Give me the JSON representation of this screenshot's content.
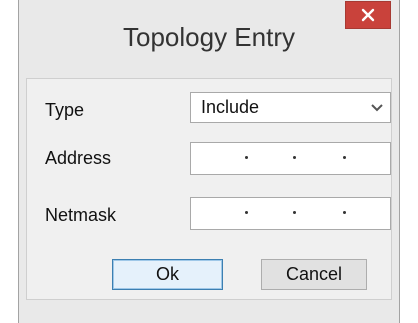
{
  "window": {
    "title": "Topology Entry",
    "close_icon": "close-icon"
  },
  "form": {
    "type_label": "Type",
    "type_value": "Include",
    "address_label": "Address",
    "netmask_label": "Netmask"
  },
  "buttons": {
    "ok_label": "Ok",
    "cancel_label": "Cancel"
  },
  "colors": {
    "close_button": "#c9423b",
    "ok_border": "#3c7fb1"
  }
}
